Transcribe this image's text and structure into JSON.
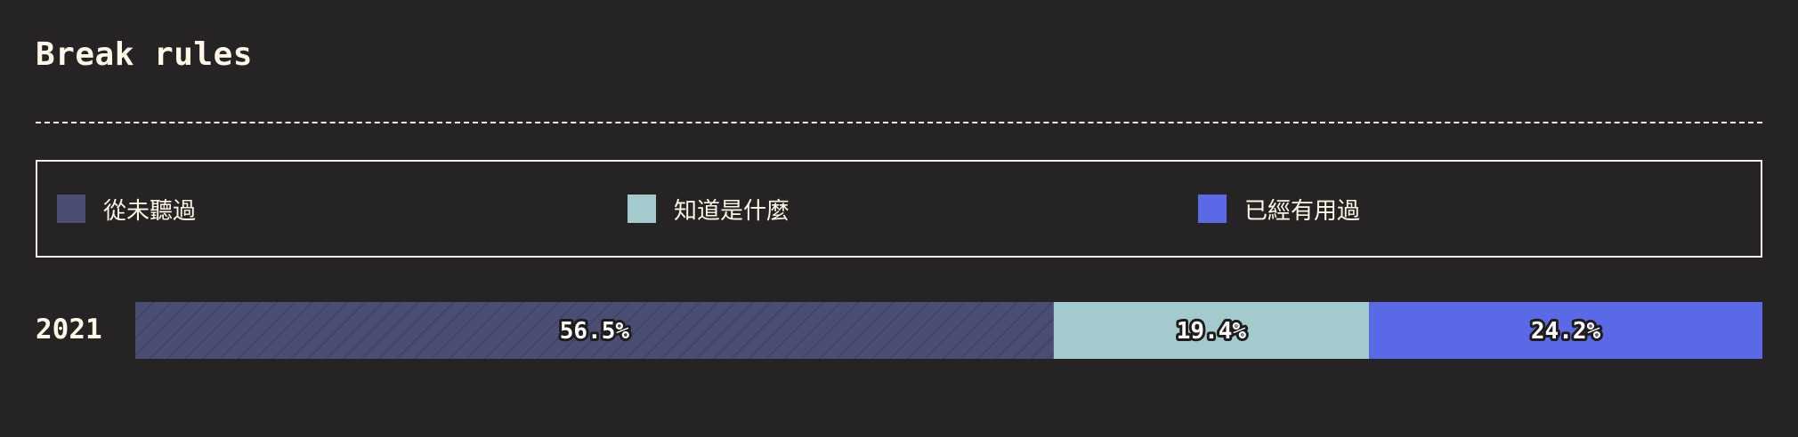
{
  "chart_data": {
    "type": "bar",
    "orientation": "horizontal",
    "stacked": true,
    "title": "Break rules",
    "categories": [
      "2021"
    ],
    "series": [
      {
        "name": "從未聽過",
        "values": [
          56.5
        ],
        "label": "56.5%",
        "color": "#4a4e73",
        "pattern": "diagonal-stripes"
      },
      {
        "name": "知道是什麼",
        "values": [
          19.4
        ],
        "label": "19.4%",
        "color": "#a3cbcd"
      },
      {
        "name": "已經有用過",
        "values": [
          24.2
        ],
        "label": "24.2%",
        "color": "#5a6ae6"
      }
    ],
    "legend_position": "top",
    "xlim": [
      0,
      100.1
    ],
    "grid": false
  },
  "colors": {
    "background": "#262324",
    "text": "#fff7e8",
    "divider": "#f3efe6"
  }
}
